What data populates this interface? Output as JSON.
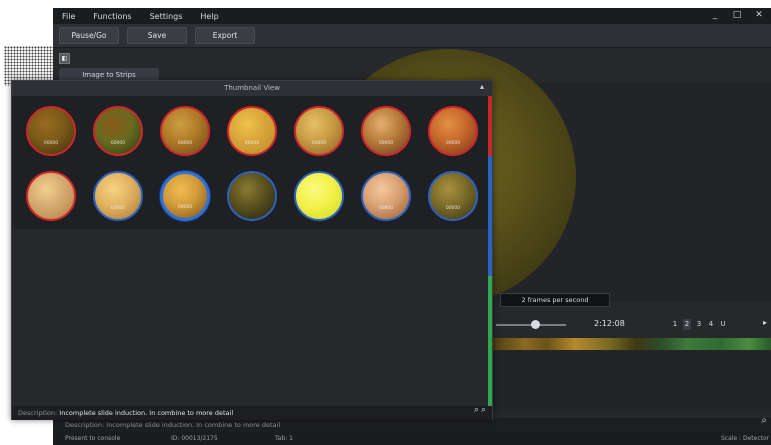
{
  "menubar": {
    "items": [
      "File",
      "Functions",
      "Settings",
      "Help"
    ],
    "window_controls": [
      "_",
      "□",
      "✕"
    ]
  },
  "toolbar": {
    "buttons": [
      "Pause/Go",
      "Save",
      "Export"
    ]
  },
  "tabs": {
    "image_strips": "Image to Strips"
  },
  "player": {
    "speed_tooltip": "2 frames per second",
    "time": "2:12:08",
    "speed_options": [
      "1",
      "2",
      "3",
      "4",
      "U"
    ],
    "active_speed": "2"
  },
  "app_status": {
    "input_text": "Description: Incomplete slide induction. In combine to more detail",
    "left": "Present to console",
    "middle": "ID: 00013/2175",
    "right_mid": "Tab: 1",
    "right": "Scale : Detector"
  },
  "dialog": {
    "title": "Thumbnail View",
    "close_icon": "close-icon",
    "description_label": "Description:",
    "description_value": "Incomplete slide induction. In combine to more detail",
    "row1": [
      {
        "label": "00000",
        "border": "#d0262c",
        "colors": [
          "#7a5a18",
          "#3e2c0c",
          "#9a6a20"
        ]
      },
      {
        "label": "00000",
        "border": "#d0262c",
        "colors": [
          "#6a6a20",
          "#2e3a10",
          "#8a5a18"
        ]
      },
      {
        "label": "00000",
        "border": "#d0262c",
        "colors": [
          "#b07a28",
          "#6a4614",
          "#caa040"
        ]
      },
      {
        "label": "00000",
        "border": "#d0262c",
        "colors": [
          "#d8a43a",
          "#b88a2a",
          "#f0c24a"
        ]
      },
      {
        "label": "00000",
        "border": "#d0262c",
        "colors": [
          "#c89a44",
          "#8a6222",
          "#e6c068"
        ]
      },
      {
        "label": "00000",
        "border": "#d0262c",
        "colors": [
          "#b87a3a",
          "#6a3a1a",
          "#e2b070"
        ]
      },
      {
        "label": "00000",
        "border": "#d0262c",
        "colors": [
          "#c4682a",
          "#7a3416",
          "#e69046"
        ]
      }
    ],
    "row2": [
      {
        "label": "",
        "border": "#d0262c",
        "colors": [
          "#d4a870",
          "#b08040",
          "#f0d090"
        ]
      },
      {
        "label": "00000",
        "border": "#2b63c2",
        "colors": [
          "#e0b060",
          "#a87a30",
          "#f6d480"
        ]
      },
      {
        "label": "00000",
        "border": "#2f6fd6",
        "colors": [
          "#d09a3a",
          "#7a5010",
          "#f0bc50"
        ],
        "selected": true
      },
      {
        "label": "",
        "border": "#2b63c2",
        "colors": [
          "#5a5020",
          "#22200a",
          "#8a7a30"
        ]
      },
      {
        "label": "",
        "border": "#2b63c2",
        "colors": [
          "#f4f04a",
          "#c8d820",
          "#fafa80"
        ]
      },
      {
        "label": "00000",
        "border": "#2b63c2",
        "colors": [
          "#d8a070",
          "#9a5a30",
          "#f4c8a0"
        ]
      },
      {
        "label": "00000",
        "border": "#2b63c2",
        "colors": [
          "#7a6a28",
          "#3a3212",
          "#a89040"
        ]
      }
    ]
  }
}
